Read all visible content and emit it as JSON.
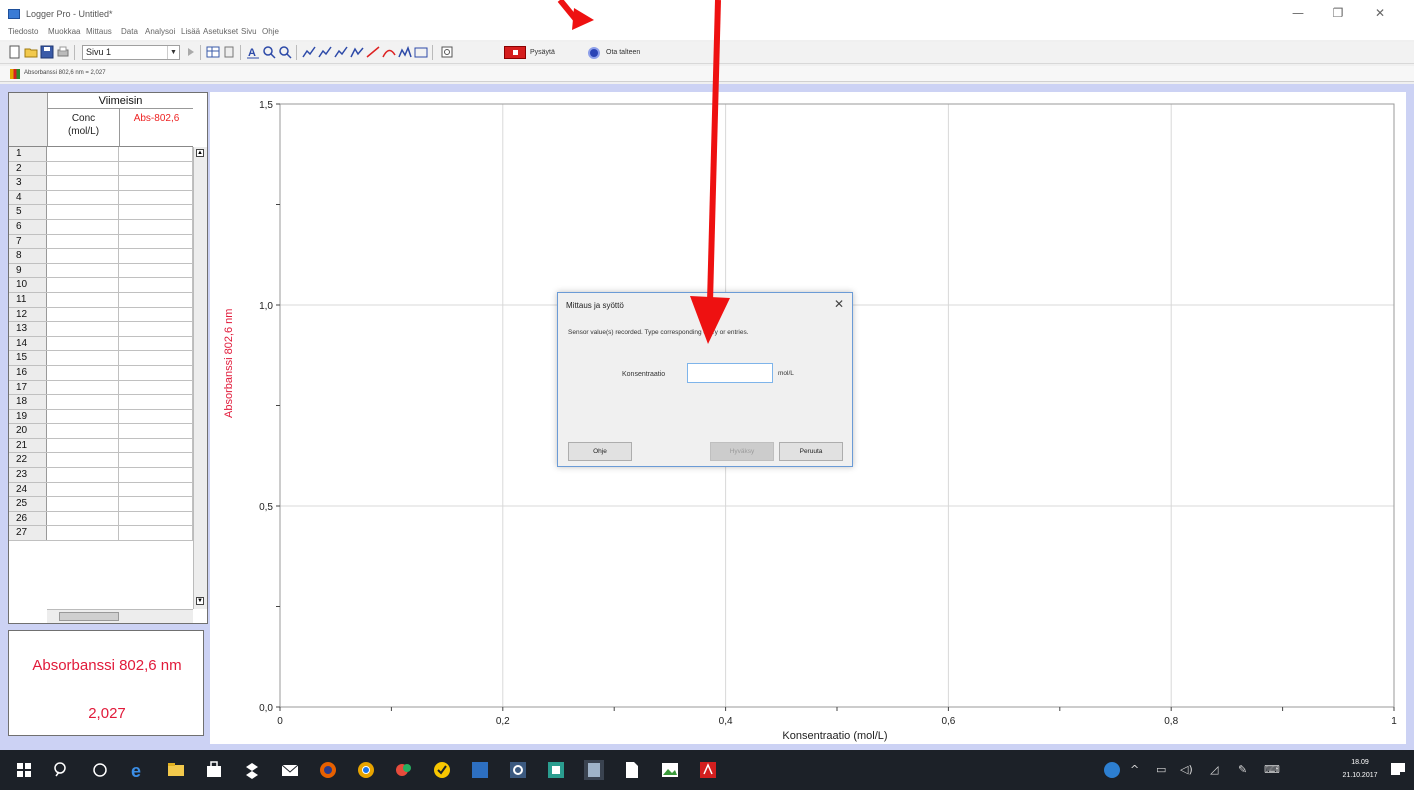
{
  "window": {
    "title": "Logger Pro - Untitled*",
    "minimize_glyph": "—",
    "restore_glyph": "❐",
    "close_glyph": "✕"
  },
  "menu": [
    "Tiedosto",
    "Muokkaa",
    "Mittaus",
    "Data",
    "Analysoi",
    "Lisää",
    "Asetukset",
    "Sivu",
    "Ohje"
  ],
  "toolbar": {
    "page_select": "Sivu 1",
    "stop_label": "Pysäytä",
    "keep_label": "Ota talteen"
  },
  "sensor_strip": {
    "text": "Absorbanssi 802,6 nm = 2,027"
  },
  "table": {
    "group_header": "Viimeisin",
    "col1_header": "Conc\n(mol/L)",
    "col2_header": "Abs-802,6",
    "row_numbers": [
      "1",
      "2",
      "3",
      "4",
      "5",
      "6",
      "7",
      "8",
      "9",
      "10",
      "11",
      "12",
      "13",
      "14",
      "15",
      "16",
      "17",
      "18",
      "19",
      "20",
      "21",
      "22",
      "23",
      "24",
      "25",
      "26",
      "27"
    ]
  },
  "meter": {
    "label": "Absorbanssi 802,6 nm",
    "value": "2,027"
  },
  "chart_data": {
    "type": "scatter",
    "title": "",
    "xlabel": "Konsentraatio (mol/L)",
    "ylabel": "Absorbanssi 802,6 nm",
    "xlim": [
      0,
      1
    ],
    "ylim": [
      0,
      1.5
    ],
    "x_ticks": [
      "0",
      "0,2",
      "0,4",
      "0,6",
      "0,8",
      "1"
    ],
    "y_ticks": [
      "0,0",
      "0,5",
      "1,0",
      "1,5"
    ],
    "grid": true,
    "series": []
  },
  "dialog": {
    "title": "Mittaus ja syöttö",
    "close_glyph": "✕",
    "message": "Sensor value(s) recorded. Type corresponding entry or entries.",
    "field_label": "Konsentraatio",
    "field_value": "",
    "unit": "mol/L",
    "help_button": "Ohje",
    "accept_button": "Hyväksy",
    "cancel_button": "Peruuta"
  },
  "taskbar": {
    "time": "18.09",
    "date": "21.10.2017"
  },
  "colors": {
    "accent_red": "#e11a3a",
    "frame_blue": "#ccd2f4",
    "annotation_arrow": "#ee1111"
  }
}
